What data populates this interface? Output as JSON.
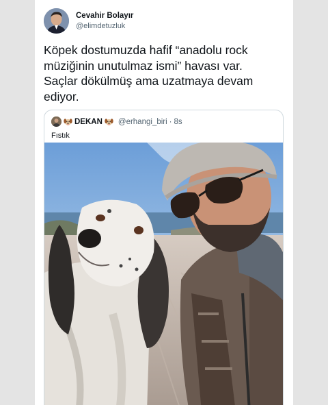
{
  "tweet": {
    "author": {
      "display_name": "Cevahir Bolayır",
      "handle": "@elimdetuzluk"
    },
    "text_lines": [
      "Köpek dostumuzda hafif “anadolu rock",
      "müziğinin unutulmaz ismi” havası var.",
      "Saçlar dökülmüş ama uzatmaya devam",
      "ediyor."
    ]
  },
  "quoted_tweet": {
    "display_name": "DEKAN",
    "handle": "@erhangi_biri",
    "separator": "·",
    "time": "8s",
    "text": "Fıstık"
  },
  "colors": {
    "text_primary": "#0f1419",
    "text_secondary": "#536471",
    "border": "#cfd9de",
    "background": "#e4e4e4"
  },
  "icons": {
    "author_avatar": "man-portrait-avatar",
    "quoted_avatar": "person-avatar",
    "emoji": "dog-face-emoji"
  }
}
